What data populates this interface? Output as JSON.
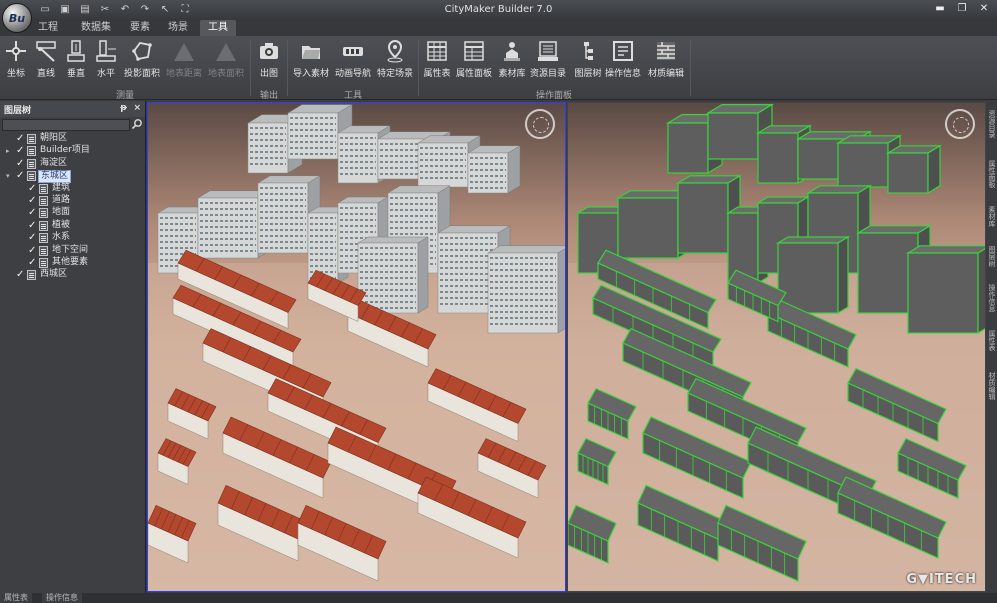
{
  "app": {
    "title": "CityMaker Builder 7.0",
    "logo_text": "Bu"
  },
  "quick_access": [
    "folder-open-icon",
    "save-icon",
    "save-as-icon",
    "cut-icon",
    "undo-icon",
    "redo-icon",
    "pointer-icon",
    "extent-icon"
  ],
  "window_controls": [
    "minimize",
    "restore",
    "close"
  ],
  "ribbon_tabs": [
    {
      "label": "工程",
      "active": false
    },
    {
      "label": "数据集",
      "active": false
    },
    {
      "label": "要素",
      "active": false
    },
    {
      "label": "场景",
      "active": false
    },
    {
      "label": "工具",
      "active": true
    }
  ],
  "ribbon": {
    "groups": [
      {
        "label": "测量",
        "buttons": [
          {
            "label": "坐标",
            "icon": "coordinate-icon",
            "enabled": true
          },
          {
            "label": "直线",
            "icon": "line-measure-icon",
            "enabled": true
          },
          {
            "label": "垂直",
            "icon": "vertical-measure-icon",
            "enabled": true
          },
          {
            "label": "水平",
            "icon": "horizontal-measure-icon",
            "enabled": true
          },
          {
            "label": "投影面积",
            "icon": "projected-area-icon",
            "enabled": true
          },
          {
            "label": "地表距离",
            "icon": "surface-distance-icon",
            "enabled": false
          },
          {
            "label": "地表面积",
            "icon": "surface-area-icon",
            "enabled": false
          }
        ]
      },
      {
        "label": "输出",
        "buttons": [
          {
            "label": "出图",
            "icon": "camera-icon",
            "enabled": true
          }
        ]
      },
      {
        "label": "工具",
        "buttons": [
          {
            "label": "导入素材",
            "icon": "import-folder-icon",
            "enabled": true
          },
          {
            "label": "动画导航",
            "icon": "animation-icon",
            "enabled": true
          },
          {
            "label": "特定场景",
            "icon": "location-pin-icon",
            "enabled": true
          }
        ]
      },
      {
        "label": "操作面板",
        "buttons": [
          {
            "label": "属性表",
            "icon": "attribute-table-icon",
            "enabled": true
          },
          {
            "label": "属性面板",
            "icon": "attribute-panel-icon",
            "enabled": true
          },
          {
            "label": "素材库",
            "icon": "material-library-icon",
            "enabled": true
          },
          {
            "label": "资源目录",
            "icon": "resource-catalog-icon",
            "enabled": true
          },
          {
            "label": "图层树",
            "icon": "layer-tree-icon",
            "enabled": true
          },
          {
            "label": "操作信息",
            "icon": "operation-info-icon",
            "enabled": true
          },
          {
            "label": "材质编辑",
            "icon": "texture-edit-icon",
            "enabled": true
          }
        ]
      }
    ]
  },
  "layer_panel": {
    "title": "图层树",
    "pin": "ᵽ",
    "close": "×",
    "tree": [
      {
        "label": "朝阳区",
        "level": 0,
        "expandable": false,
        "expanded": false,
        "checked": true,
        "selected": false
      },
      {
        "label": "Builder项目",
        "level": 0,
        "expandable": true,
        "expanded": false,
        "checked": true,
        "selected": false
      },
      {
        "label": "海淀区",
        "level": 0,
        "expandable": false,
        "expanded": false,
        "checked": true,
        "selected": false
      },
      {
        "label": "东城区",
        "level": 0,
        "expandable": true,
        "expanded": true,
        "checked": true,
        "selected": true
      },
      {
        "label": "建筑",
        "level": 1,
        "expandable": false,
        "expanded": false,
        "checked": true,
        "selected": false
      },
      {
        "label": "道路",
        "level": 1,
        "expandable": false,
        "expanded": false,
        "checked": true,
        "selected": false
      },
      {
        "label": "地面",
        "level": 1,
        "expandable": false,
        "expanded": false,
        "checked": true,
        "selected": false
      },
      {
        "label": "植被",
        "level": 1,
        "expandable": false,
        "expanded": false,
        "checked": true,
        "selected": false
      },
      {
        "label": "水系",
        "level": 1,
        "expandable": false,
        "expanded": false,
        "checked": true,
        "selected": false
      },
      {
        "label": "地下空间",
        "level": 1,
        "expandable": false,
        "expanded": false,
        "checked": true,
        "selected": false
      },
      {
        "label": "其他要素",
        "level": 1,
        "expandable": false,
        "expanded": false,
        "checked": true,
        "selected": false
      },
      {
        "label": "西城区",
        "level": 0,
        "expandable": false,
        "expanded": false,
        "checked": true,
        "selected": false
      }
    ]
  },
  "viewports": {
    "left": {
      "mode": "textured"
    },
    "right": {
      "mode": "wireframe"
    },
    "watermark": "G▼ITECH"
  },
  "right_dock_tabs": [
    "资源目录",
    "属性面板",
    "素材库",
    "图层树",
    "操作信息",
    "属性表",
    "材质编辑"
  ],
  "bottom_tabs": [
    "属性表",
    "操作信息"
  ],
  "colors": {
    "accent": "#2a3cff",
    "selection": "#d8e6ff",
    "wireframe": "#39d33a",
    "roof": "#b4482e"
  }
}
